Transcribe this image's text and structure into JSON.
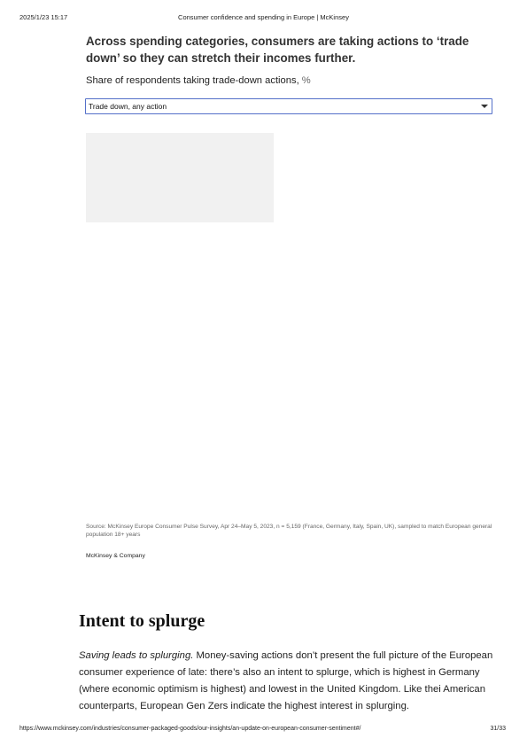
{
  "print_header": {
    "datetime": "2025/1/23 15:17",
    "title": "Consumer confidence and spending in Europe | McKinsey"
  },
  "exhibit": {
    "title": "Across spending categories, consumers are taking actions to ‘trade down’ so they can stretch their incomes further.",
    "subtitle": "Share of respondents taking trade-down actions,",
    "unit": "%",
    "dropdown": {
      "selected": "Trade down, any action",
      "icon": "caret-down-icon"
    },
    "source": "Source: McKinsey Europe Consumer Pulse Survey, Apr 24–May 5, 2023, n = 5,159 (France, Germany, Italy, Spain, UK), sampled to match European general population 18+ years",
    "credit": "McKinsey & Company"
  },
  "article": {
    "heading": "Intent to splurge",
    "paragraph_italic": "Saving leads to splurging.",
    "paragraph_rest": " Money-saving actions don’t present the full picture of the European consumer experience of late: there’s also an intent to splurge, which is highest in Germany (where economic optimism is highest) and lowest in the United Kingdom. Like thei American counterparts, European Gen Zers indicate the highest interest in splurging."
  },
  "print_footer": {
    "url": "https://www.mckinsey.com/industries/consumer-packaged-goods/our-insights/an-update-on-european-consumer-sentiment#/",
    "page": "31/33"
  },
  "colors": {
    "dropdown_border": "#5470c9",
    "placeholder_fill": "#f1f1f1"
  }
}
